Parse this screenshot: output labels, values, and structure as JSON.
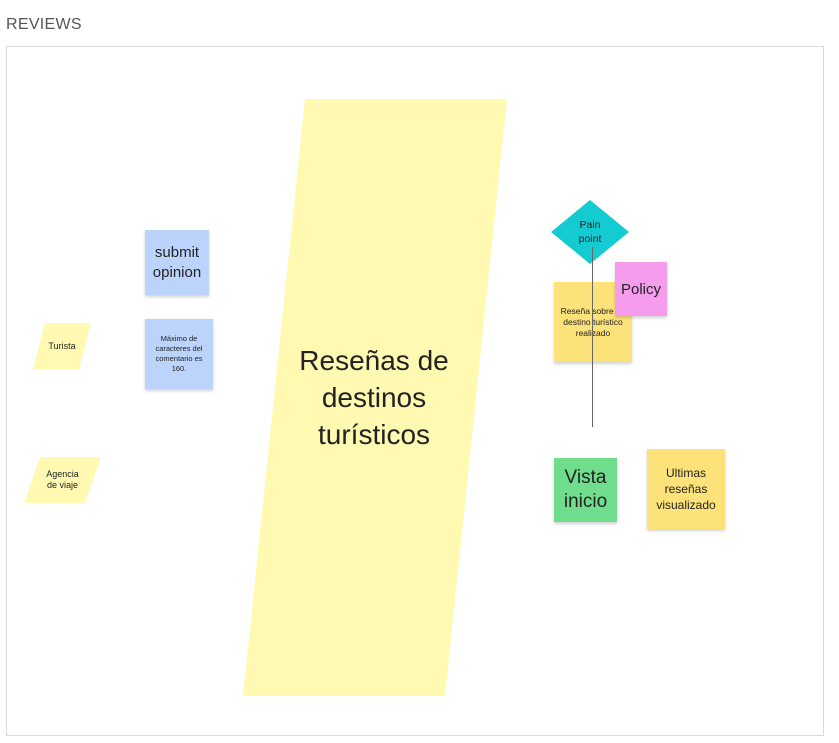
{
  "section": {
    "title": "REVIEWS"
  },
  "colors": {
    "yellow_light": "#fff9b1",
    "yellow_note": "#fde27a",
    "blue_note": "#bcd4fb",
    "green_note": "#6fdd8b",
    "pink_note": "#f59cec",
    "cyan_shape": "#15cbd2"
  },
  "board": {
    "main_parallelogram": {
      "text": "Reseñas de destinos turísticos"
    },
    "actors": [
      {
        "text": "Turista"
      },
      {
        "text": "Agencia de viaje"
      }
    ],
    "notes": {
      "submit_opinion": "submit opinion",
      "max_chars": "Máximo de caracteres del comentario es 160.",
      "resena_realizado": "Reseña sobre un destino turístico realizado",
      "policy": "Policy",
      "vista_inicio": "Vista inicio",
      "ultimas_resenas": "Ultimas reseñas visualizado"
    },
    "pain_point": {
      "text": "Pain point"
    }
  }
}
